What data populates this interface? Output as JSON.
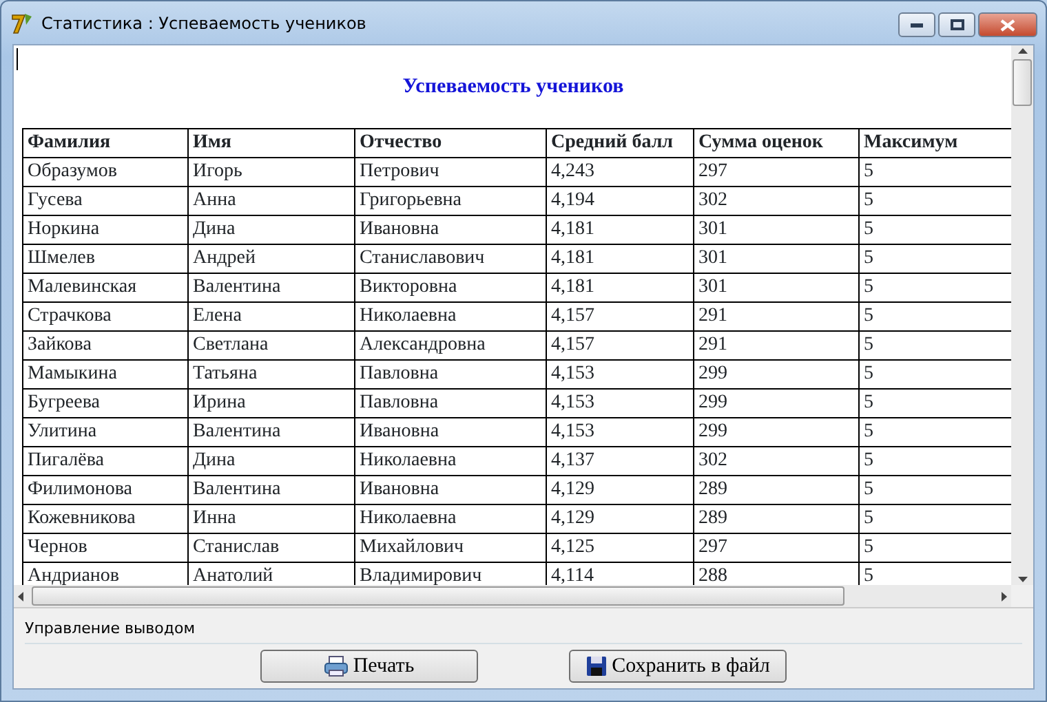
{
  "window": {
    "title": "Статистика : Успеваемость учеников"
  },
  "report": {
    "title": "Успеваемость учеников",
    "columns": [
      "Фамилия",
      "Имя",
      "Отчество",
      "Средний балл",
      "Сумма оценок",
      "Максимум"
    ],
    "rows": [
      [
        "Образумов",
        "Игорь",
        "Петрович",
        "4,243",
        "297",
        "5"
      ],
      [
        "Гусева",
        "Анна",
        "Григорьевна",
        "4,194",
        "302",
        "5"
      ],
      [
        "Норкина",
        "Дина",
        "Ивановна",
        "4,181",
        "301",
        "5"
      ],
      [
        "Шмелев",
        "Андрей",
        "Станиславович",
        "4,181",
        "301",
        "5"
      ],
      [
        "Малевинская",
        "Валентина",
        "Викторовна",
        "4,181",
        "301",
        "5"
      ],
      [
        "Страчкова",
        "Елена",
        "Николаевна",
        "4,157",
        "291",
        "5"
      ],
      [
        "Зайкова",
        "Светлана",
        "Александровна",
        "4,157",
        "291",
        "5"
      ],
      [
        "Мамыкина",
        "Татьяна",
        "Павловна",
        "4,153",
        "299",
        "5"
      ],
      [
        "Бугреева",
        "Ирина",
        "Павловна",
        "4,153",
        "299",
        "5"
      ],
      [
        "Улитина",
        "Валентина",
        "Ивановна",
        "4,153",
        "299",
        "5"
      ],
      [
        "Пигалёва",
        "Дина",
        "Николаевна",
        "4,137",
        "302",
        "5"
      ],
      [
        "Филимонова",
        "Валентина",
        "Ивановна",
        "4,129",
        "289",
        "5"
      ],
      [
        "Кожевникова",
        "Инна",
        "Николаевна",
        "4,129",
        "289",
        "5"
      ],
      [
        "Чернов",
        "Станислав",
        "Михайлович",
        "4,125",
        "297",
        "5"
      ],
      [
        "Андрианов",
        "Анатолий",
        "Владимирович",
        "4,114",
        "288",
        "5"
      ]
    ]
  },
  "output_group": {
    "label": "Управление выводом",
    "buttons": [
      {
        "kind": "print",
        "label": "Печать"
      },
      {
        "kind": "save",
        "label": "Сохранить в файл"
      }
    ]
  }
}
